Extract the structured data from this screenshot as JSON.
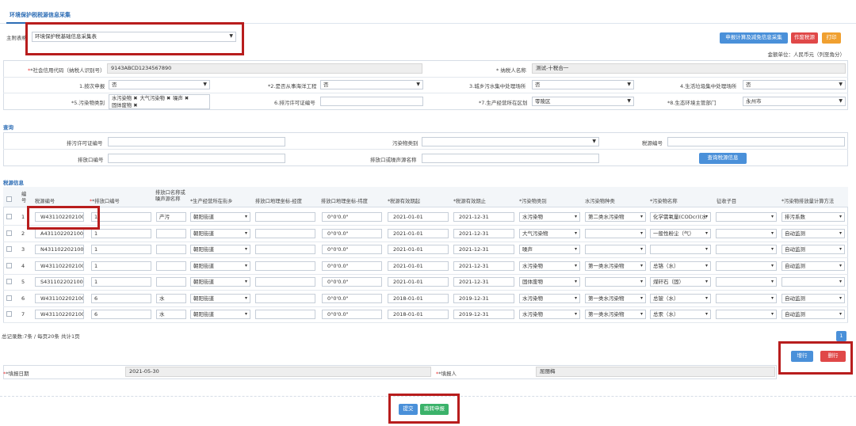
{
  "tab_title": "环境保护税税源信息采集",
  "main_table": {
    "label": "主附表格",
    "value": "环境保护税基础信息采集表"
  },
  "top_buttons": {
    "declare_calc": "申报计算及减免信息采集",
    "void": "作废税源",
    "print": "打印"
  },
  "unit_note": "金额单位：人民币元（列至角分）",
  "basic": {
    "credit_code_label": "*社会信用代码（纳税人识别号）",
    "credit_code_value": "9143ABCD1234567890",
    "taxpayer_name_label": "* 纳税人名称",
    "taxpayer_name_value": "测试-十税合一",
    "q1_label": "1.按次申报",
    "q1_value": "否",
    "q2_label": "*2.是否从事海洋工程",
    "q2_value": "否",
    "q3_label": "3.城乡污水集中处理场所",
    "q3_value": "否",
    "q4_label": "4.生活垃圾集中处理场所",
    "q4_value": "否",
    "q5_label": "*5.污染物类别",
    "q5_tags": [
      "水污染物",
      "大气污染物",
      "噪声",
      "固体废物"
    ],
    "q6_label": "6.排污许可证编号",
    "q7_label": "*7.生产经营所在区划",
    "q7_value": "零陵区",
    "q8_label": "*8.生态环境主管部门",
    "q8_value": "永州市"
  },
  "query": {
    "section_title": "查询",
    "permit_label": "排污许可证编号",
    "pollutant_cat_label": "污染物类别",
    "source_no_label": "税源编号",
    "outlet_no_label": "排放口编号",
    "outlet_name_label": "排放口或噪声源名称",
    "query_button": "查询税源信息"
  },
  "source": {
    "section_title": "税源信息",
    "headers": {
      "idx": "编号",
      "source_no": "税源编号",
      "outlet_no": "*排放口编号",
      "outlet_name": "排放口名称或噪声源名称",
      "street": "*生产经营所在街乡",
      "lon": "排放口地理坐标-经度",
      "lat": "排放口地理坐标-纬度",
      "start": "*税源有效期起",
      "end": "*税源有效期止",
      "pcat": "*污染物类别",
      "wtype": "水污染物种类",
      "pname": "*污染物名称",
      "item": "征收子目",
      "method": "*污染物排放量计算方法"
    },
    "rows": [
      {
        "idx": "1",
        "source_no": "W4311022021000",
        "outlet_no": "1",
        "outlet_name": "产污",
        "street": "朝阳街道",
        "lon": "",
        "lat": "0°0'0.0\"",
        "start": "2021-01-01",
        "end": "2021-12-31",
        "pcat": "水污染物",
        "wtype": "第二类水污染物",
        "pname": "化学需氧量(CODcr)(水",
        "item": "",
        "method": "排污系数"
      },
      {
        "idx": "2",
        "source_no": "A4311022021000",
        "outlet_no": "1",
        "outlet_name": "",
        "street": "朝阳街道",
        "lon": "",
        "lat": "0°0'0.0\"",
        "start": "2021-01-01",
        "end": "2021-12-31",
        "pcat": "大气污染物",
        "wtype": "",
        "pname": "一般性粉尘（气）",
        "item": "",
        "method": "自动监测"
      },
      {
        "idx": "3",
        "source_no": "N4311022021000",
        "outlet_no": "1",
        "outlet_name": "",
        "street": "朝阳街道",
        "lon": "",
        "lat": "0°0'0.0\"",
        "start": "2021-01-01",
        "end": "2021-12-31",
        "pcat": "噪声",
        "wtype": "",
        "pname": "",
        "item": "",
        "method": "自动监测"
      },
      {
        "idx": "4",
        "source_no": "W4311022021000",
        "outlet_no": "1",
        "outlet_name": "",
        "street": "朝阳街道",
        "lon": "",
        "lat": "0°0'0.0\"",
        "start": "2021-01-01",
        "end": "2021-12-31",
        "pcat": "水污染物",
        "wtype": "第一类水污染物",
        "pname": "总铬（水）",
        "item": "",
        "method": "自动监测"
      },
      {
        "idx": "5",
        "source_no": "S4311022021000",
        "outlet_no": "1",
        "outlet_name": "",
        "street": "朝阳街道",
        "lon": "",
        "lat": "0°0'0.0\"",
        "start": "2021-01-01",
        "end": "2021-12-31",
        "pcat": "固体废物",
        "wtype": "",
        "pname": "煤矸石（固）",
        "item": "",
        "method": ""
      },
      {
        "idx": "6",
        "source_no": "W4311022021000",
        "outlet_no": "6",
        "outlet_name": "水",
        "street": "朝阳街道",
        "lon": "",
        "lat": "0°0'0.0\"",
        "start": "2018-01-01",
        "end": "2019-12-31",
        "pcat": "水污染物",
        "wtype": "第一类水污染物",
        "pname": "总铍（水）",
        "item": "",
        "method": "自动监测"
      },
      {
        "idx": "7",
        "source_no": "W4311022021000",
        "outlet_no": "6",
        "outlet_name": "水",
        "street": "朝阳街道",
        "lon": "",
        "lat": "0°0'0.0\"",
        "start": "2018-01-01",
        "end": "2019-12-31",
        "pcat": "水污染物",
        "wtype": "第一类水污染物",
        "pname": "总汞（水）",
        "item": "",
        "method": "自动监测"
      }
    ]
  },
  "pager": {
    "summary": "总记录数:7条 / 每页20条 共计1页",
    "page": "1"
  },
  "row_buttons": {
    "add": "增行",
    "delete": "删行"
  },
  "footer": {
    "fill_date_label": "*填报日期",
    "fill_date_value": "2021-05-30",
    "filler_label": "*填报人",
    "filler_value": "屈丽梅"
  },
  "bottom_buttons": {
    "submit": "提交",
    "jump": "跳转申报"
  }
}
